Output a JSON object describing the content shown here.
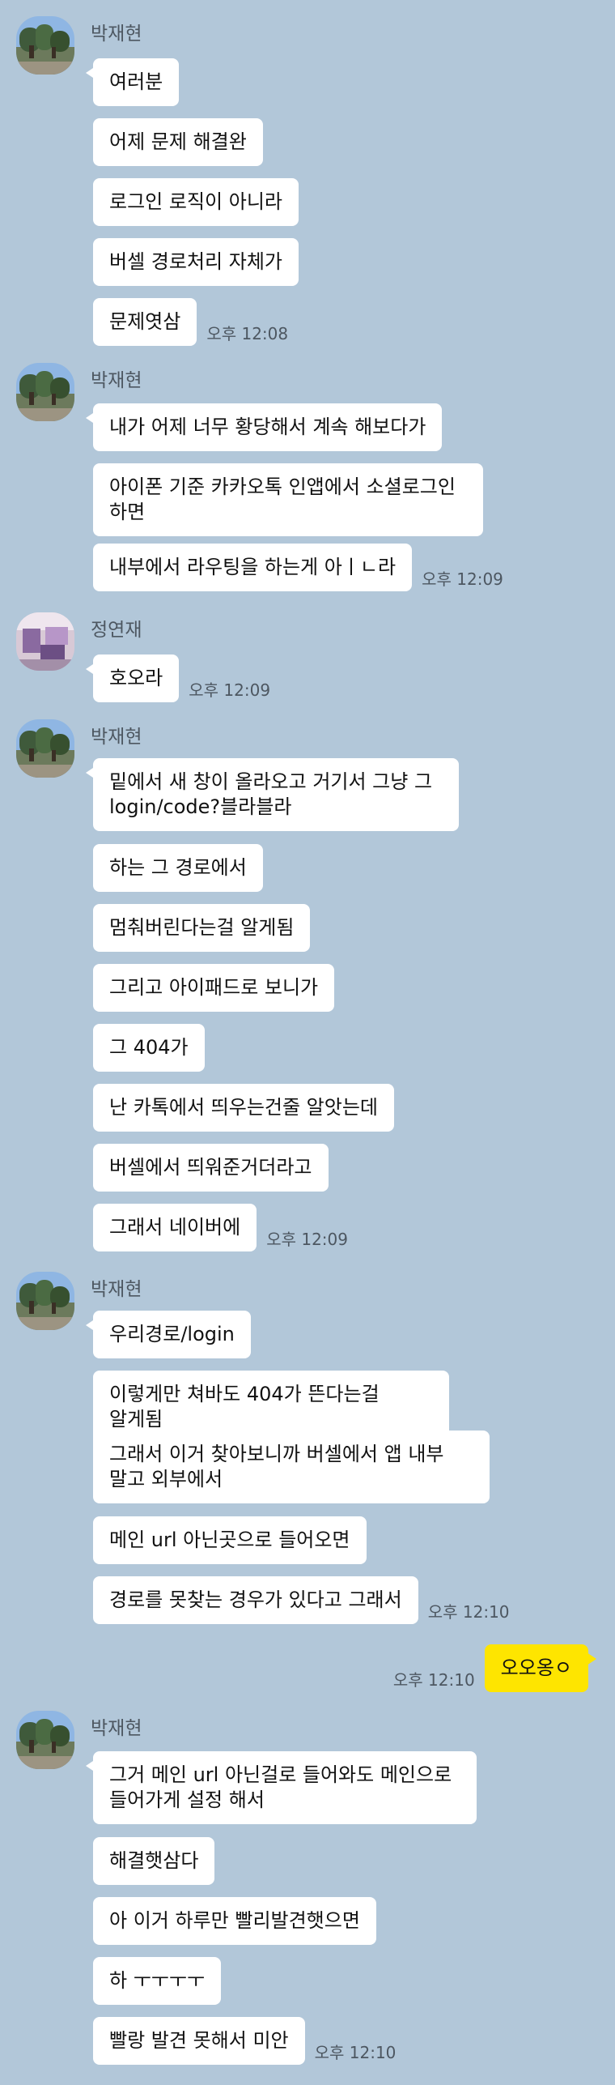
{
  "groups": [
    {
      "sender": "박재현",
      "avatar": "profile-photo-trees",
      "messages": [
        "여러분",
        "어제 문제 해결완",
        "로그인 로직이 아니라",
        "버셀 경로처리 자체가",
        "문제엿삼"
      ],
      "time": "오후 12:08"
    },
    {
      "sender": "박재현",
      "avatar": "profile-photo-trees",
      "messages": [
        "내가 어제 너무 황당해서 계속 해보다가",
        "아이폰 기준 카카오톡 인앱에서 소셜로그인 하면",
        "내부에서 라우팅을 하는게 아ㅣㄴ라"
      ],
      "time": "오후 12:09"
    },
    {
      "sender": "정연재",
      "avatar": "profile-photo-room",
      "messages": [
        "호오라"
      ],
      "time": "오후 12:09"
    },
    {
      "sender": "박재현",
      "avatar": "profile-photo-trees",
      "messages": [
        "밑에서 새 창이 올라오고 거기서 그냥 그 login/code?블라블라",
        "하는 그 경로에서",
        "멈춰버린다는걸 알게됨",
        "그리고 아이패드로 보니가",
        "그 404가",
        "난 카톡에서 띄우는건줄 알앗는데",
        "버셀에서 띄워준거더라고",
        "그래서 네이버에"
      ],
      "time": "오후 12:09"
    },
    {
      "sender": "박재현",
      "avatar": "profile-photo-trees",
      "messages": [
        "우리경로/login",
        "이렇게만 쳐바도 404가 뜬다는걸 알게됨",
        "그래서 이거 찾아보니까 버셀에서 앱 내부 말고 외부에서",
        "메인 url 아닌곳으로 들어오면",
        "경로를 못찾는 경우가 있다고 그래서"
      ],
      "time": "오후 12:10"
    },
    {
      "sender": "박재현",
      "avatar": "profile-photo-trees",
      "messages": [
        "그거 메인 url 아닌걸로 들어와도 메인으로 들어가게 설정 해서",
        "해결햇삼다",
        "아 이거 하루만 빨리발견햇으면",
        "하 ㅜㅜㅜㅜ",
        "빨랑 발견 못해서 미안"
      ],
      "time": "오후 12:10"
    }
  ],
  "my_message": {
    "text": "오오옹ㅇ",
    "time": "오후 12:10"
  }
}
